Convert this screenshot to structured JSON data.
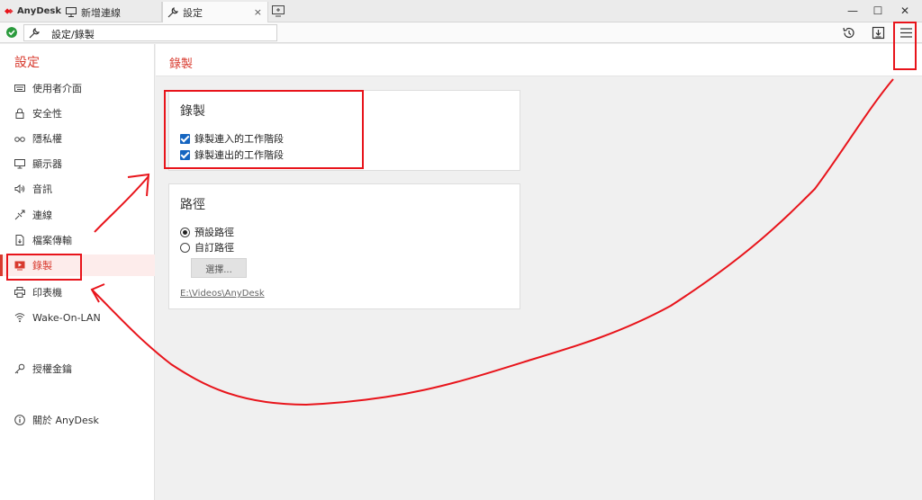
{
  "app": {
    "brand": "AnyDesk"
  },
  "tabs": [
    {
      "label": "新增連線",
      "icon": "monitor-icon"
    },
    {
      "label": "設定",
      "icon": "wrench-icon",
      "close": "×"
    }
  ],
  "window": {
    "minimize": "—",
    "maximize": "☐",
    "close": "✕"
  },
  "address": {
    "value": "設定/錄製"
  },
  "toolbar_icons": [
    "history-icon",
    "download-icon",
    "menu-icon"
  ],
  "sidebar": {
    "title": "設定",
    "items": [
      {
        "label": "使用者介面",
        "icon": "keyboard-icon"
      },
      {
        "label": "安全性",
        "icon": "lock-icon"
      },
      {
        "label": "隱私權",
        "icon": "glasses-icon"
      },
      {
        "label": "顯示器",
        "icon": "monitor-icon"
      },
      {
        "label": "音訊",
        "icon": "speaker-icon"
      },
      {
        "label": "連線",
        "icon": "connection-icon"
      },
      {
        "label": "檔案傳輸",
        "icon": "file-icon"
      },
      {
        "label": "錄製",
        "icon": "record-icon",
        "active": true
      },
      {
        "label": "印表機",
        "icon": "printer-icon"
      },
      {
        "label": "Wake-On-LAN",
        "icon": "wifi-icon"
      },
      {
        "label": "授權金鑰",
        "icon": "key-icon"
      },
      {
        "label": "關於 AnyDesk",
        "icon": "info-icon"
      }
    ]
  },
  "main": {
    "title": "錄製",
    "recording": {
      "title": "錄製",
      "options": [
        "錄製連入的工作階段",
        "錄製連出的工作階段"
      ],
      "checked": [
        true,
        true
      ]
    },
    "path": {
      "title": "路徑",
      "options": [
        "預設路徑",
        "自訂路徑"
      ],
      "selected": 0,
      "choose_button": "選擇...",
      "current_path": "E:\\Videos\\AnyDesk"
    }
  },
  "colors": {
    "accent": "#d83a2e",
    "checkbox": "#1565c0",
    "annotation": "#e8141b",
    "ok": "#2a9a3c"
  }
}
